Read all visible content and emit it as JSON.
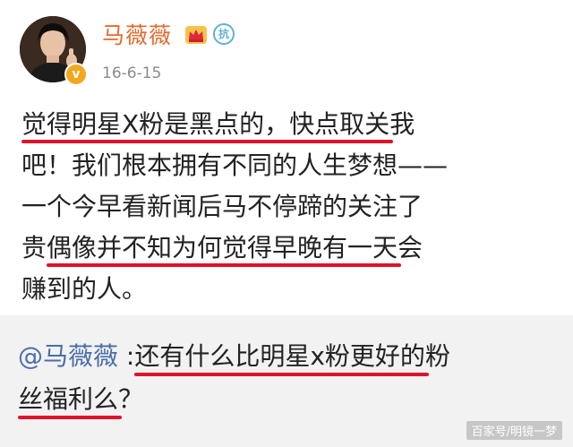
{
  "post": {
    "username": "马薇薇",
    "verified_mark": "v",
    "member_badge_text": "抗",
    "timestamp": "16-6-15",
    "lines": [
      [
        "觉得明星X粉是黑点的，快点取关",
        "我"
      ],
      [
        "吧！我们根本拥有不同的人生梦想——"
      ],
      [
        "一个今早看新闻后马不停蹄的关注了"
      ],
      [
        "贵",
        "偶像并不知为何觉得早晚有一天",
        "会"
      ],
      [
        "赚到的人。"
      ]
    ]
  },
  "comment": {
    "mention": "@马薇薇",
    "separator": " :",
    "text_line1": "还有什么比明星x粉更好的",
    "text_line1_tail": "粉",
    "text_line2": "丝福利么",
    "text_line2_tail": "？"
  },
  "watermark": "百家号/明镜一梦",
  "colors": {
    "username": "#e76a2c",
    "underline": "#e0122a",
    "mention": "#4a6ea9",
    "comment_bg": "#f2f2f2"
  }
}
